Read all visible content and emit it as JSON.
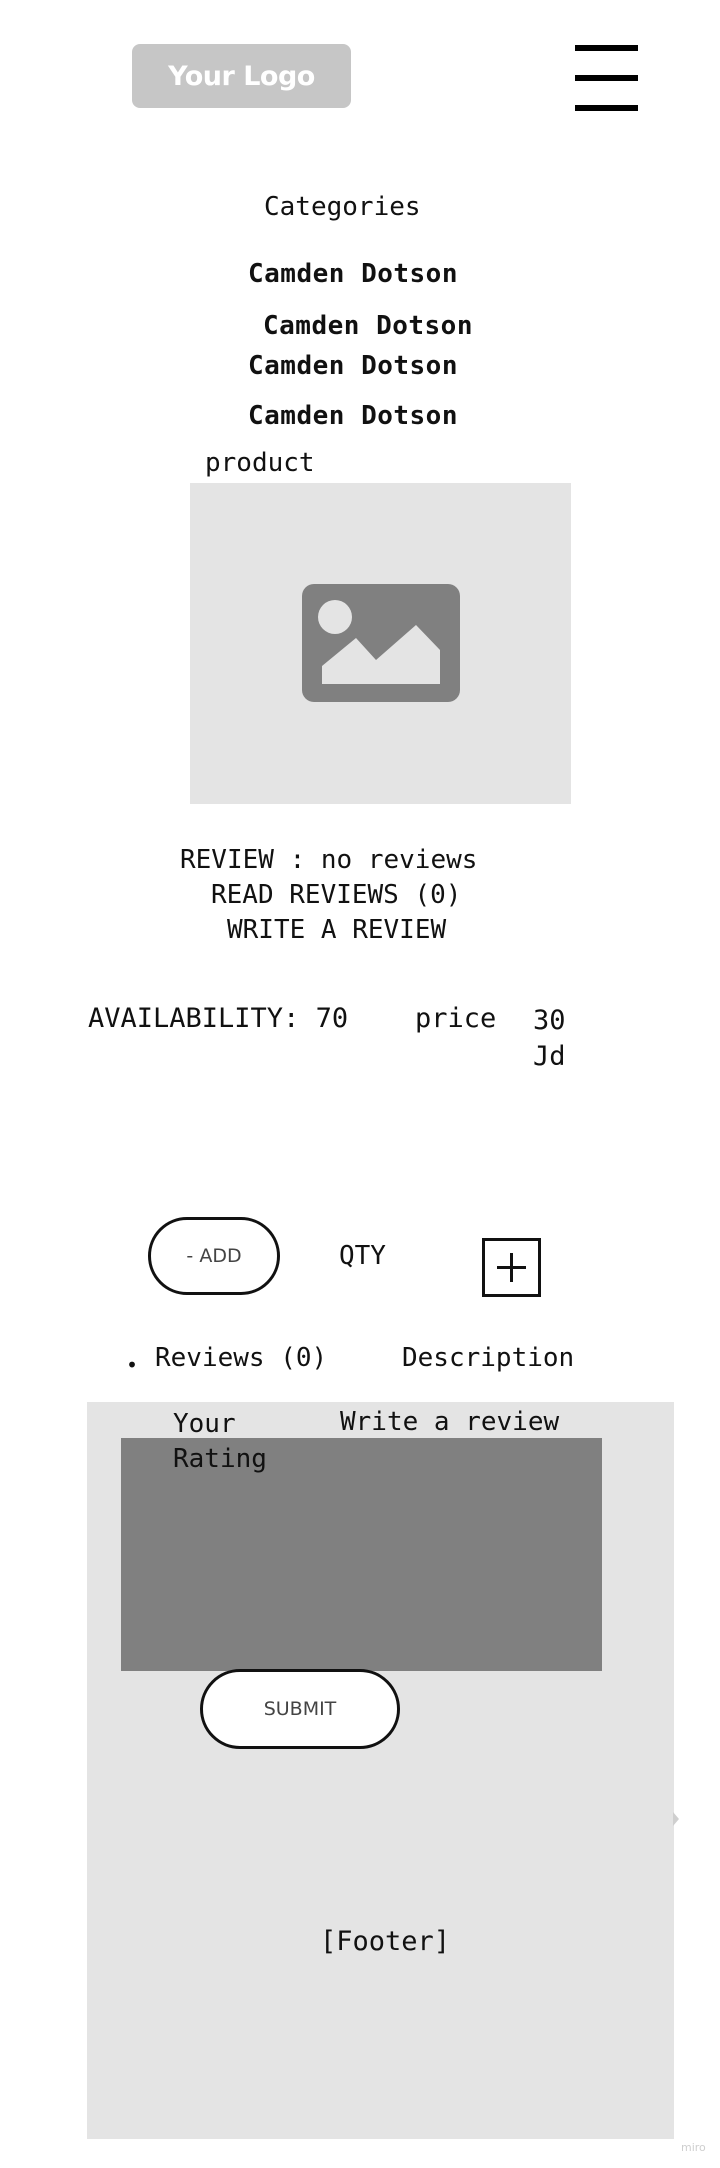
{
  "header": {
    "logo_text": "Your Logo",
    "menu_icon": "hamburger-menu-icon"
  },
  "categories": {
    "heading": "Categories",
    "items": [
      {
        "label": "Camden Dotson"
      },
      {
        "label": "Camden Dotson"
      },
      {
        "label": "Camden Dotson"
      },
      {
        "label": "Camden Dotson"
      }
    ]
  },
  "product": {
    "label": "product",
    "image_icon": "image-placeholder-icon",
    "review_status": "REVIEW : no reviews",
    "read_reviews": "READ REVIEWS (0)",
    "write_review": "WRITE A REVIEW",
    "availability": "AVAILABILITY: 70",
    "price_label": "price",
    "price_value": "30 Jd"
  },
  "purchase": {
    "add_label": "- ADD",
    "qty_label": "QTY",
    "plus_icon": "plus-icon"
  },
  "tabs": {
    "bullet": "•",
    "reviews": "Reviews (0)",
    "description": "Description"
  },
  "review_form": {
    "rating_label": "Your Rating",
    "write_label": "Write a review",
    "submit_label": "SUBMIT"
  },
  "footer": {
    "label": "[Footer]"
  },
  "watermark": "miro",
  "colors": {
    "logo_bg": "#c6c6c6",
    "placeholder_bg": "#e4e4e4",
    "textarea_bg": "#808080",
    "icon_gray": "#808080"
  }
}
